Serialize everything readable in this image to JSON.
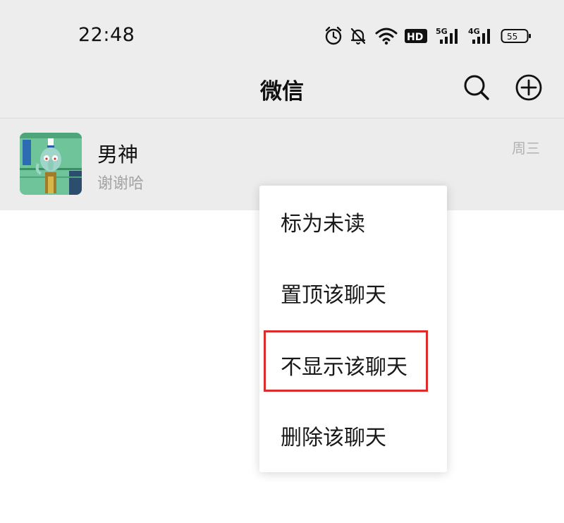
{
  "status_bar": {
    "time": "22:48",
    "icons": [
      "alarm-icon",
      "bell-muted-icon",
      "wifi-icon",
      "hd-icon",
      "signal-5g-icon",
      "signal-4g-icon",
      "battery-icon"
    ],
    "hd_label": "HD",
    "net1_label": "5G",
    "net2_label": "4G",
    "battery_level": "55"
  },
  "header": {
    "title": "微信",
    "search_icon": "search-icon",
    "add_icon": "plus-circle-icon"
  },
  "chat_list": [
    {
      "name": "男神",
      "preview": "谢谢哈",
      "time": "周三",
      "avatar": "squidward-cartoon-avatar"
    }
  ],
  "context_menu": {
    "items": [
      {
        "label": "标为未读"
      },
      {
        "label": "置顶该聊天"
      },
      {
        "label": "不显示该聊天",
        "highlighted": true
      },
      {
        "label": "删除该聊天"
      }
    ],
    "highlight_color": "#dd2c2c"
  },
  "colors": {
    "header_bg": "#ededed",
    "row_bg": "#ececec",
    "muted_text": "#a3a3a3"
  }
}
